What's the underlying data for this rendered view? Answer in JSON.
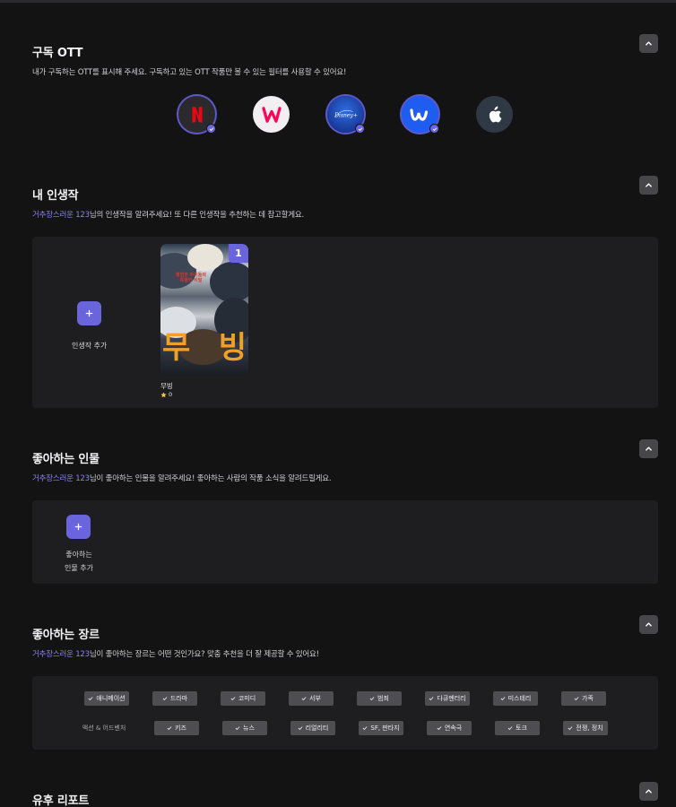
{
  "ott_section": {
    "title": "구독 OTT",
    "description": "내가 구독하는 OTT를 표시해 주세요. 구독하고 있는 OTT 작품만 볼 수 있는 필터를 사용할 수 있어요!",
    "services": [
      {
        "name": "Netflix",
        "icon": "netflix-logo",
        "selected": true
      },
      {
        "name": "Watcha",
        "icon": "watcha-logo",
        "selected": false
      },
      {
        "name": "Disney+",
        "icon": "disney-plus-logo",
        "selected": true
      },
      {
        "name": "Wavve",
        "icon": "wavve-logo",
        "selected": true
      },
      {
        "name": "Apple TV+",
        "icon": "apple-logo",
        "selected": false
      }
    ]
  },
  "favorite_work_section": {
    "title": "내 인생작",
    "username": "거추장스러운 123",
    "description_suffix": "님의 인생작을 알려주세요! 또 다른 인생작을 추천하는 데 참고할게요.",
    "add_label": "인생작 추가",
    "items": [
      {
        "rank": "1",
        "title": "무빙",
        "rating": "0",
        "poster_tagline": "평범한 아이들의 특별한 비밀",
        "poster_big_left": "무",
        "poster_big_right": "빙"
      }
    ]
  },
  "favorite_people_section": {
    "title": "좋아하는 인물",
    "username": "거추장스러운 123",
    "description_suffix": "님이 좋아하는 인물을 알려주세요! 좋아하는 사람의 작품 소식을 알려드릴게요.",
    "add_label_line1": "좋아하는",
    "add_label_line2": "인물 추가"
  },
  "genre_section": {
    "title": "좋아하는 장르",
    "username": "거추장스러운 123",
    "description_suffix": "님이 좋아하는 장르는 어떤 것인가요? 맞춤 추천을 더 잘 제공할 수 있어요!",
    "genres": [
      {
        "label": "애니메이션",
        "selected": true
      },
      {
        "label": "드라마",
        "selected": true
      },
      {
        "label": "코미디",
        "selected": true
      },
      {
        "label": "서부",
        "selected": true
      },
      {
        "label": "범죄",
        "selected": true
      },
      {
        "label": "다큐멘터리",
        "selected": true
      },
      {
        "label": "미스테리",
        "selected": true
      },
      {
        "label": "가족",
        "selected": true
      },
      {
        "label": "액션 & 어드벤처",
        "selected": false
      },
      {
        "label": "키즈",
        "selected": true
      },
      {
        "label": "뉴스",
        "selected": true
      },
      {
        "label": "리얼리티",
        "selected": true
      },
      {
        "label": "SF, 판타지",
        "selected": true
      },
      {
        "label": "연속극",
        "selected": true
      },
      {
        "label": "토크",
        "selected": true
      },
      {
        "label": "전쟁, 정치",
        "selected": true
      }
    ]
  },
  "report_section": {
    "title": "유후 리포트"
  },
  "colors": {
    "background": "#131314",
    "panel": "#1e1e20",
    "accent": "#6a65dc",
    "username": "#8a86f2",
    "chip": "#4d4d52"
  }
}
